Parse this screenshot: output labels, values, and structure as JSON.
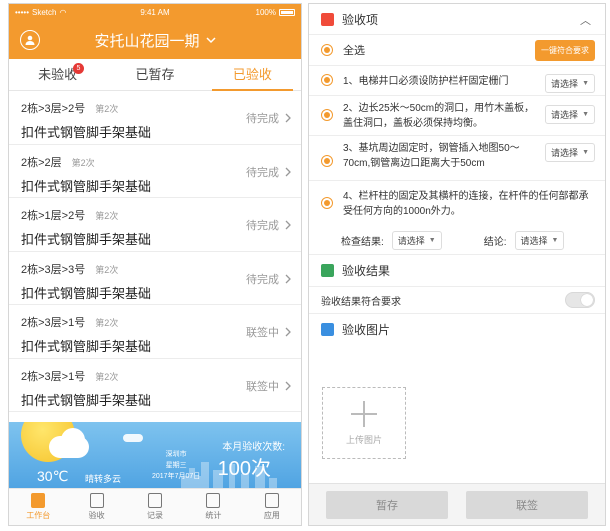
{
  "colors": {
    "accent": "#f39a2e",
    "badge": "#e53935",
    "muted": "#999999"
  },
  "left": {
    "status_bar": {
      "carrier": "Sketch",
      "time": "9:41 AM",
      "battery": "100%"
    },
    "nav": {
      "title": "安托山花园一期",
      "icon": "user-icon"
    },
    "tabs": [
      {
        "label": "未验收",
        "badge": "5"
      },
      {
        "label": "已暂存"
      },
      {
        "label": "已验收"
      }
    ],
    "tasks": [
      {
        "location": "2栋>3层>2号",
        "batch": "第2次",
        "name": "扣件式钢管脚手架基础",
        "status": "待完成"
      },
      {
        "location": "2栋>2层",
        "batch": "第2次",
        "name": "扣件式钢管脚手架基础",
        "status": "待完成"
      },
      {
        "location": "2栋>1层>2号",
        "batch": "第2次",
        "name": "扣件式钢管脚手架基础",
        "status": "待完成"
      },
      {
        "location": "2栋>3层>3号",
        "batch": "第2次",
        "name": "扣件式钢管脚手架基础",
        "status": "待完成"
      },
      {
        "location": "2栋>3层>1号",
        "batch": "第2次",
        "name": "扣件式钢管脚手架基础",
        "status": "联签中"
      },
      {
        "location": "2栋>3层>1号",
        "batch": "第2次",
        "name": "扣件式钢管脚手架基础",
        "status": "联签中"
      }
    ],
    "weather": {
      "temp": "30℃",
      "desc": "晴转多云",
      "city": "深圳市",
      "weekday": "星期三",
      "date": "2017年7月07日",
      "count_label": "本月验收次数:",
      "count": "100次"
    },
    "tabbar": [
      {
        "label": "工作台",
        "icon": "workbench-icon"
      },
      {
        "label": "验收",
        "icon": "document-icon"
      },
      {
        "label": "记录",
        "icon": "record-icon"
      },
      {
        "label": "统计",
        "icon": "chart-icon"
      },
      {
        "label": "应用",
        "icon": "apps-icon"
      }
    ]
  },
  "right": {
    "items_header": {
      "title": "验收项",
      "icon": "checklist-icon"
    },
    "select_all": {
      "label": "全选",
      "button": "一键符合要求"
    },
    "check_items": [
      {
        "text": "1、电梯井口必须设防护栏杆固定栅门",
        "select": "请选择"
      },
      {
        "text": "2、边长25米～50cm的洞口，用竹木盖板，盖住洞口，盖板必须保持均衡。",
        "select": "请选择"
      },
      {
        "text": "3、基坑周边固定时，钢管插入地图50～70cm,钢管离边口距离大于50cm",
        "select": "请选择"
      },
      {
        "text": "4、栏杆柱的固定及其横杆的连接，在杆件的任何部都承受任何方向的1000n外力。",
        "select": ""
      }
    ],
    "check_result_label": "检查结果:",
    "check_result_select": "请选择",
    "conclusion_label": "结论:",
    "conclusion_select": "请选择",
    "result_header": {
      "title": "验收结果",
      "icon": "result-icon"
    },
    "result_toggle_label": "验收结果符合要求",
    "images_header": {
      "title": "验收图片",
      "icon": "image-icon"
    },
    "upload_label": "上传图片",
    "buttons": {
      "save": "暂存",
      "sign": "联签"
    }
  }
}
